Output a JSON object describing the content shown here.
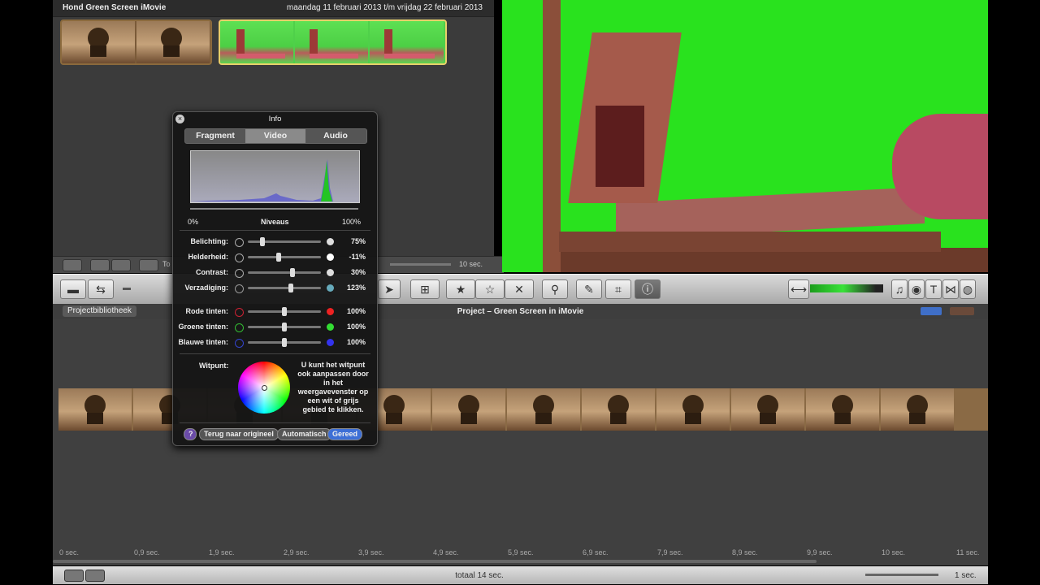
{
  "event_browser": {
    "title": "Hond Green Screen iMovie",
    "date_range": "maandag 11 februari 2013 t/m vrijdag 22 februari 2013"
  },
  "event_toolbar": {
    "zoom_label": "10 sec.",
    "truncated_label": "To"
  },
  "project": {
    "library_button": "Projectbibliotheek",
    "title": "Project – Green Screen in iMovie"
  },
  "timeline": {
    "ticks": [
      "0 sec.",
      "0,9 sec.",
      "1,9 sec.",
      "2,9 sec.",
      "3,9 sec.",
      "4,9 sec.",
      "5,9 sec.",
      "6,9 sec.",
      "7,9 sec.",
      "8,9 sec.",
      "9,9 sec.",
      "10 sec.",
      "11 sec."
    ],
    "total": "totaal 14 sec.",
    "zoom": "1 sec."
  },
  "info_panel": {
    "title": "Info",
    "tabs": [
      "Fragment",
      "Video",
      "Audio"
    ],
    "active_tab": "Video",
    "levels": {
      "min": "0%",
      "label": "Niveaus",
      "max": "100%"
    },
    "rows": [
      {
        "label": "Belichting:",
        "value": "75%",
        "level": 0.18
      },
      {
        "label": "Helderheid:",
        "value": "-11%",
        "level": 0.42
      },
      {
        "label": "Contrast:",
        "value": "30%",
        "level": 0.62
      },
      {
        "label": "Verzadiging:",
        "value": "123%",
        "level": 0.6
      },
      {
        "label": "Rode tinten:",
        "value": "100%",
        "level": 0.5
      },
      {
        "label": "Groene tinten:",
        "value": "100%",
        "level": 0.5
      },
      {
        "label": "Blauwe tinten:",
        "value": "100%",
        "level": 0.5
      }
    ],
    "whitepoint_label": "Witpunt:",
    "whitepoint_help": "U kunt het witpunt ook aanpassen door in het weergavevenster op een wit of grijs gebied te klikken.",
    "buttons": {
      "help": "?",
      "revert": "Terug naar origineel",
      "auto": "Automatisch",
      "done": "Gereed"
    }
  },
  "colors": {
    "viewer_green": "#29e21e",
    "done_button": "#3d6fd6",
    "active_tab": "#8a8a8a"
  }
}
